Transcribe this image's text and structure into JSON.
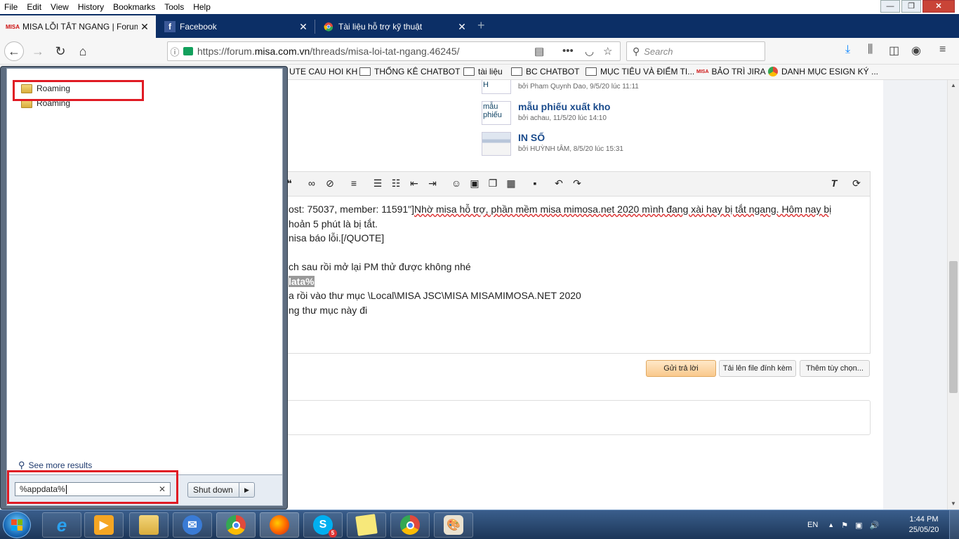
{
  "menubar": {
    "items": [
      "File",
      "Edit",
      "View",
      "History",
      "Bookmarks",
      "Tools",
      "Help"
    ]
  },
  "window_controls": {
    "minimize": "—",
    "maximize": "❐",
    "close": "✕"
  },
  "tabs": [
    {
      "label": "MISA LỖI TẮT NGANG | Forum",
      "favicon_text": "MISA"
    },
    {
      "label": "Facebook",
      "favicon_text": "f"
    },
    {
      "label": "Tài liệu hỗ trợ kỹ thuật",
      "favicon_text": ""
    }
  ],
  "tab_close": "✕",
  "new_tab": "+",
  "url": {
    "prefix": "https://forum.",
    "domain": "misa.com.vn",
    "path": "/threads/misa-loi-tat-ngang.46245/"
  },
  "search": {
    "placeholder": "Search"
  },
  "bookmarks": [
    "UTE CAU HOI KH",
    "THỐNG KÊ CHATBOT",
    "tài liệu",
    "BC CHATBOT",
    "MỤC TIÊU VÀ ĐIỂM TI...",
    "BẢO TRÌ JIRA",
    "DANH MỤC ESIGN KÝ ..."
  ],
  "related_threads": [
    {
      "thumb": "H",
      "title": "",
      "meta": "bởi Pham Quynh Dao, 9/5/20 lúc 11:11"
    },
    {
      "thumb": "mẫu phiếu",
      "title": "mẫu phiếu xuất kho",
      "meta": "bởi achau, 11/5/20 lúc 14:10"
    },
    {
      "thumb": "",
      "title": "IN SỐ",
      "meta": "bởi HUỲNH tÂM, 8/5/20 lúc 15:31"
    }
  ],
  "editor": {
    "line1_a": "ost: 75037, member: 11591\"]",
    "line1_b": "Nhờ misa hỗ trợ, phần mềm misa mimosa.net 2020 mình đang xài hay bị tắt ngang. Hôm nay bị",
    "line2": "hoản 5 phút là bị tắt.",
    "line3": "nisa báo lỗi.[/QUOTE]",
    "line4": "ch sau rồi mở lại PM thử được không nhé",
    "line5": "lata%",
    "line6": "a rồi vào thư mục \\Local\\MISA JSC\\MISA MISAMIMOSA.NET 2020",
    "line7": "ng thư mục này đi"
  },
  "buttons": {
    "send": "Gửi trả lời",
    "upload": "Tải lên file đính kèm",
    "more": "Thêm tùy chọn..."
  },
  "start_menu": {
    "results": [
      "Roaming",
      "Roaming"
    ],
    "see_more": "See more results",
    "search_value": "%appdata%",
    "clear": "✕",
    "shutdown": "Shut down",
    "shutdown_arrow": "▶"
  },
  "taskbar": {
    "lang": "EN",
    "time": "1:44 PM",
    "date": "25/05/20",
    "skype_badge": "5"
  }
}
